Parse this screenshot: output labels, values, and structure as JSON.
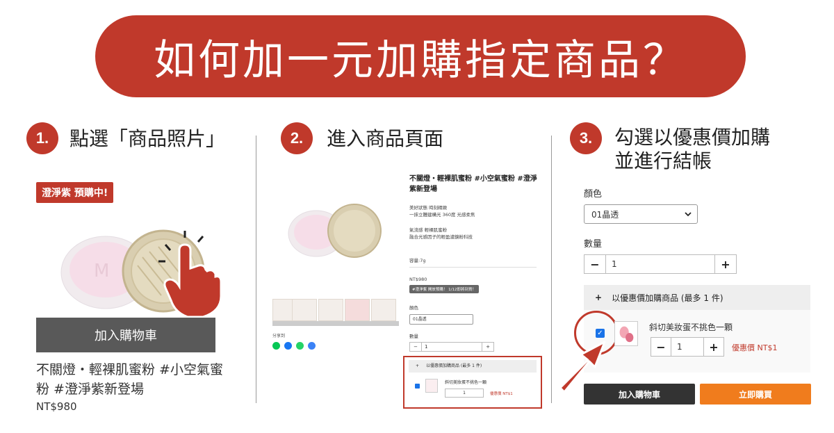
{
  "title": "如何加一元加購指定商品？",
  "steps": [
    {
      "num": "1.",
      "text": "點選「商品照片」"
    },
    {
      "num": "2.",
      "text": "進入商品頁面"
    },
    {
      "num": "3.",
      "text_line1": "勾選以優惠價加購",
      "text_line2": "並進行結帳"
    }
  ],
  "panel1": {
    "badge": "澄淨紫 預購中!",
    "add_to_cart": "加入購物車",
    "product_name": "不關燈・輕裸肌蜜粉 #小空氣蜜粉 #澄淨紫新登場",
    "price": "NT$980"
  },
  "panel2": {
    "product_title": "不關燈・輕裸肌蜜粉 #小空氣蜜粉 #澄淨紫新登場",
    "desc1_line1": "美好狀態 時刻精緻",
    "desc1_line2": "一抹立體建構光 360度 光感柔焦",
    "desc2_line1": "氣流感 輕裸肌蜜粉",
    "desc2_line2": "融合光感因子的輕盈濾鏡粉科技",
    "capacity": "容量:7g",
    "price": "NT$980",
    "tag": "#澄淨紫 開放預購！ 1/12即將到貨！",
    "color_label": "顏色",
    "color_value": "01晶透",
    "qty_label": "數量",
    "qty_minus": "−",
    "qty_value": "1",
    "qty_plus": "+",
    "share_label": "分享到",
    "addon_header": "以優惠價加購商品 (最多 1 件)",
    "addon_plus": "+",
    "addon_name": "斜切美妝蛋不挑色一顆",
    "addon_qty": "1",
    "addon_promo": "優惠價 NT$1"
  },
  "panel3": {
    "color_label": "顏色",
    "color_value": "01晶透",
    "qty_label": "數量",
    "qty_minus": "−",
    "qty_value": "1",
    "qty_plus": "+",
    "addon_plus": "+",
    "addon_header": "以優惠價加購商品 (最多 1 件)",
    "addon_check": "✓",
    "addon_name": "斜切美妝蛋不挑色一顆",
    "addon_qty": "1",
    "addon_promo": "優惠價 NT$1",
    "add_to_cart": "加入購物車",
    "buy_now": "立即購買"
  },
  "colors": {
    "accent": "#c0392b",
    "orange": "#f07c1d",
    "dark": "#333333"
  }
}
